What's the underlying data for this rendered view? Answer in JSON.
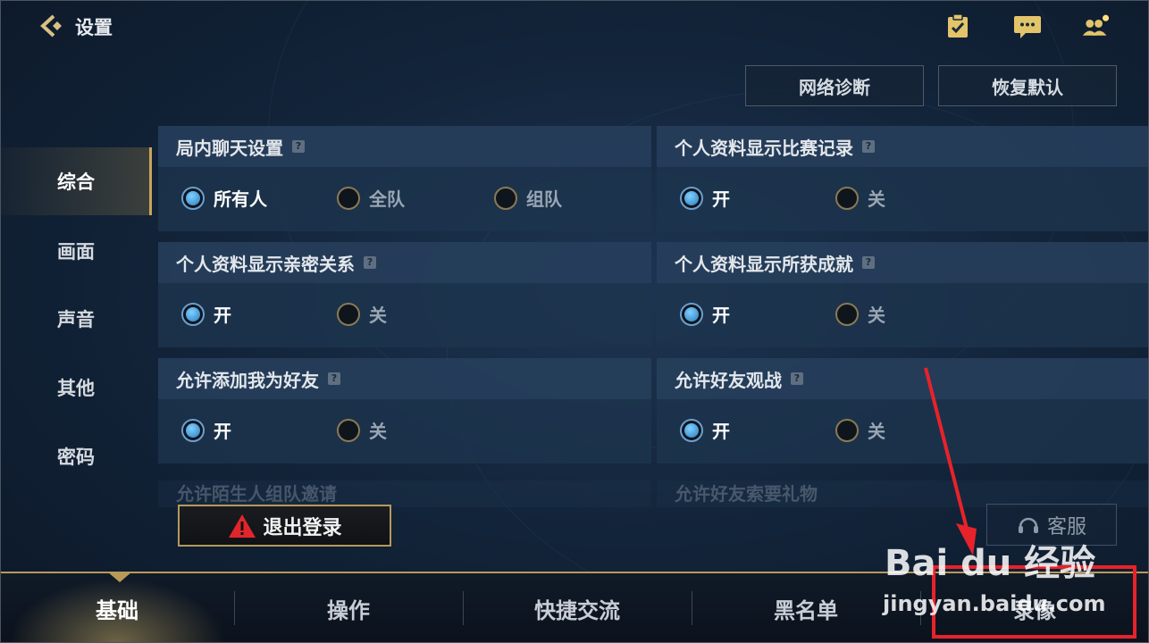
{
  "header": {
    "title": "设置",
    "icons": [
      "checklist-icon",
      "chat-icon",
      "friends-icon"
    ]
  },
  "actions": {
    "network_diagnosis": "网络诊断",
    "restore_default": "恢复默认"
  },
  "side_nav": {
    "items": [
      "综合",
      "画面",
      "声音",
      "其他",
      "密码"
    ],
    "active_index": 0
  },
  "settings": [
    {
      "title": "局内聊天设置",
      "options": [
        "所有人",
        "全队",
        "组队"
      ],
      "selected": 0
    },
    {
      "title": "个人资料显示比赛记录",
      "options": [
        "开",
        "关"
      ],
      "selected": 0
    },
    {
      "title": "个人资料显示亲密关系",
      "options": [
        "开",
        "关"
      ],
      "selected": 0
    },
    {
      "title": "个人资料显示所获成就",
      "options": [
        "开",
        "关"
      ],
      "selected": 0
    },
    {
      "title": "允许添加我为好友",
      "options": [
        "开",
        "关"
      ],
      "selected": 0
    },
    {
      "title": "允许好友观战",
      "options": [
        "开",
        "关"
      ],
      "selected": 0
    }
  ],
  "partial_settings": [
    "允许陌生人组队邀请",
    "允许好友索要礼物"
  ],
  "logout_label": "退出登录",
  "customer_service_label": "客服",
  "bottom_tabs": {
    "items": [
      "基础",
      "操作",
      "快捷交流",
      "黑名单",
      "录像"
    ],
    "active_index": 0
  },
  "watermark": {
    "brand": "Bai du 经验",
    "url": "jingyan.baidu.com"
  },
  "colors": {
    "accent_gold": "#b89a58",
    "radio_active": "#2a7cc0",
    "annotation_red": "#e8222a"
  }
}
